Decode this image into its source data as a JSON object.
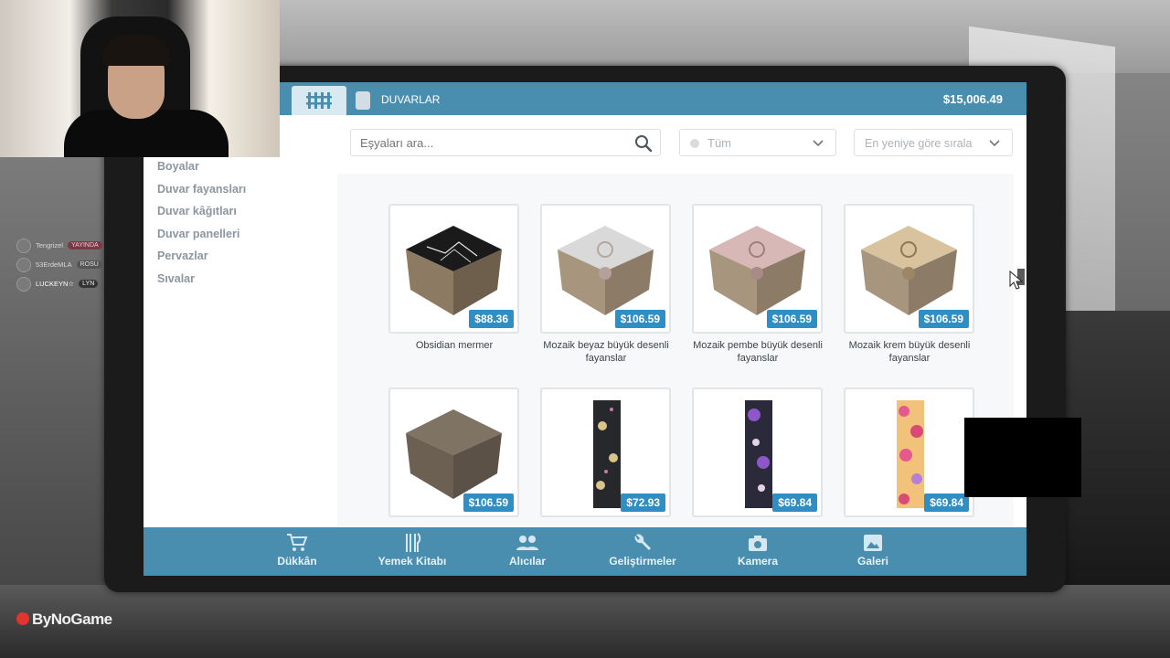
{
  "header": {
    "section_title": "DUVARLAR",
    "balance": "$15,006.49"
  },
  "sidebar": {
    "items": [
      {
        "label": "Boyalar"
      },
      {
        "label": "Duvar fayansları"
      },
      {
        "label": "Duvar kâğıtları"
      },
      {
        "label": "Duvar panelleri"
      },
      {
        "label": "Pervazlar"
      },
      {
        "label": "Sıvalar"
      }
    ]
  },
  "search": {
    "placeholder": "Eşyaları ara..."
  },
  "filter": {
    "selected": "Tüm"
  },
  "sort": {
    "selected": "En yeniye göre sırala"
  },
  "products": [
    {
      "name": "Obsidian mermer",
      "price": "$88.36",
      "icon": "black-marble-tile-cube"
    },
    {
      "name": "Mozaik beyaz büyük desenli fayanslar",
      "price": "$106.59",
      "icon": "white-mosaic-tile-cube"
    },
    {
      "name": "Mozaik pembe büyük desenli fayanslar",
      "price": "$106.59",
      "icon": "pink-mosaic-tile-cube"
    },
    {
      "name": "Mozaik krem büyük desenli fayanslar",
      "price": "$106.59",
      "icon": "cream-mosaic-tile-cube"
    },
    {
      "name": "",
      "price": "$106.59",
      "icon": "brown-stone-tile-cube"
    },
    {
      "name": "",
      "price": "$72.93",
      "icon": "dark-skull-wallpaper-strip"
    },
    {
      "name": "",
      "price": "$69.84",
      "icon": "purple-skull-wallpaper-strip"
    },
    {
      "name": "",
      "price": "$69.84",
      "icon": "pink-circles-wallpaper-strip"
    }
  ],
  "bottom_nav": [
    {
      "label": "Dükkân",
      "icon": "cart-icon"
    },
    {
      "label": "Yemek Kitabı",
      "icon": "cutlery-icon"
    },
    {
      "label": "Alıcılar",
      "icon": "people-icon"
    },
    {
      "label": "Geliştirmeler",
      "icon": "wrench-icon"
    },
    {
      "label": "Kamera",
      "icon": "camera-icon"
    },
    {
      "label": "Galeri",
      "icon": "image-icon"
    }
  ],
  "chat": [
    {
      "user": "Tengrizel",
      "badge": "YAYINDA"
    },
    {
      "user": "53ErdeMLA",
      "badge": "ROSU"
    },
    {
      "user": "LUCKEYN☆",
      "badge": "LYN"
    }
  ],
  "overlay_logo": "ByNoGame",
  "colors": {
    "accent": "#4a8eaf",
    "price_badge": "#2f8ec3"
  }
}
